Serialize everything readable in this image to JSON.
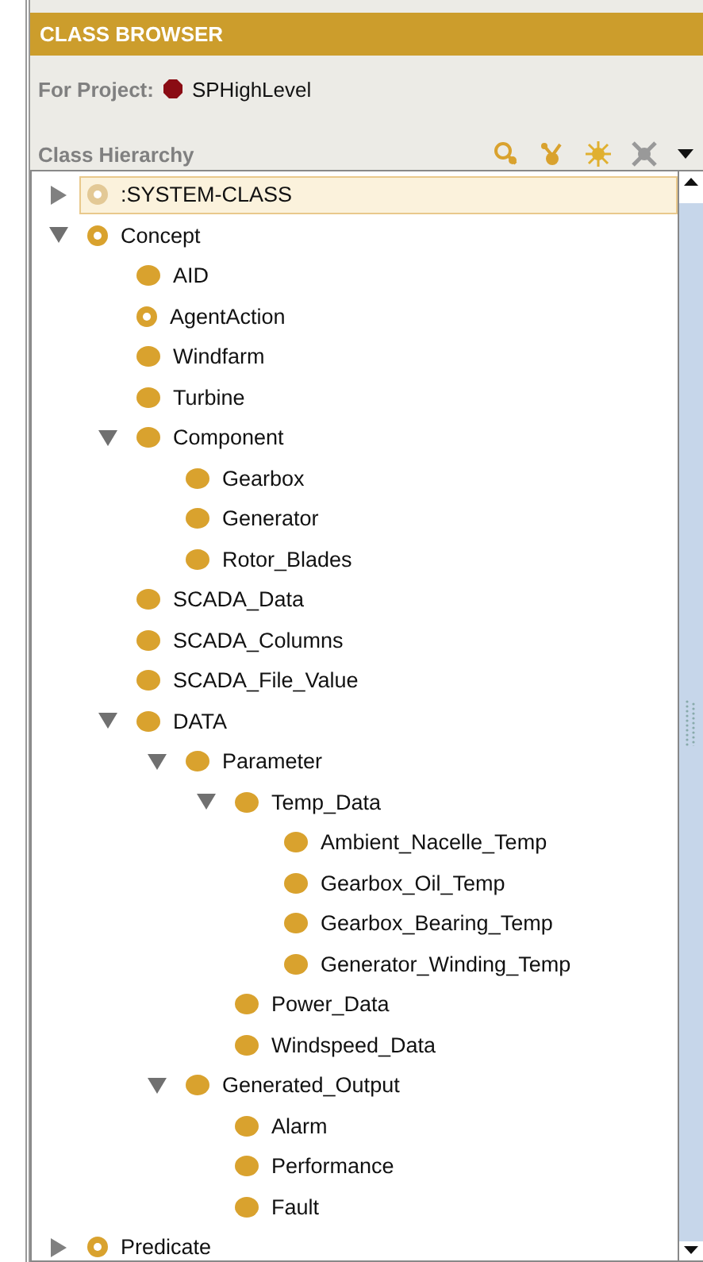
{
  "header": {
    "title": "CLASS BROWSER"
  },
  "project": {
    "label": "For Project:",
    "name": "SPHighLevel"
  },
  "hierarchy": {
    "label": "Class Hierarchy"
  },
  "tree": [
    {
      "label": ":SYSTEM-CLASS",
      "kind": "system",
      "selected": true,
      "expanded": false
    },
    {
      "label": "Concept",
      "kind": "abstract",
      "selected": false,
      "expanded": true,
      "children": [
        {
          "label": "AID",
          "kind": "concrete",
          "selected": false
        },
        {
          "label": "AgentAction",
          "kind": "abstract",
          "selected": false
        },
        {
          "label": "Windfarm",
          "kind": "concrete",
          "selected": false
        },
        {
          "label": "Turbine",
          "kind": "concrete",
          "selected": false
        },
        {
          "label": "Component",
          "kind": "concrete",
          "selected": false,
          "expanded": true,
          "children": [
            {
              "label": "Gearbox",
              "kind": "concrete",
              "selected": false
            },
            {
              "label": "Generator",
              "kind": "concrete",
              "selected": false
            },
            {
              "label": "Rotor_Blades",
              "kind": "concrete",
              "selected": false
            }
          ]
        },
        {
          "label": "SCADA_Data",
          "kind": "concrete",
          "selected": false
        },
        {
          "label": "SCADA_Columns",
          "kind": "concrete",
          "selected": false
        },
        {
          "label": "SCADA_File_Value",
          "kind": "concrete",
          "selected": false
        },
        {
          "label": "DATA",
          "kind": "concrete",
          "selected": false,
          "expanded": true,
          "children": [
            {
              "label": "Parameter",
              "kind": "concrete",
              "selected": false,
              "expanded": true,
              "children": [
                {
                  "label": "Temp_Data",
                  "kind": "concrete",
                  "selected": false,
                  "expanded": true,
                  "children": [
                    {
                      "label": "Ambient_Nacelle_Temp",
                      "kind": "concrete",
                      "selected": false
                    },
                    {
                      "label": "Gearbox_Oil_Temp",
                      "kind": "concrete",
                      "selected": false
                    },
                    {
                      "label": "Gearbox_Bearing_Temp",
                      "kind": "concrete",
                      "selected": false
                    },
                    {
                      "label": "Generator_Winding_Temp",
                      "kind": "concrete",
                      "selected": false
                    }
                  ]
                },
                {
                  "label": "Power_Data",
                  "kind": "concrete",
                  "selected": false
                },
                {
                  "label": "Windspeed_Data",
                  "kind": "concrete",
                  "selected": false
                }
              ]
            },
            {
              "label": "Generated_Output",
              "kind": "concrete",
              "selected": false,
              "expanded": true,
              "children": [
                {
                  "label": "Alarm",
                  "kind": "concrete",
                  "selected": false
                },
                {
                  "label": "Performance",
                  "kind": "concrete",
                  "selected": false
                },
                {
                  "label": "Fault",
                  "kind": "concrete",
                  "selected": false
                }
              ]
            }
          ]
        }
      ]
    },
    {
      "label": "Predicate",
      "kind": "abstract",
      "selected": false,
      "expanded": false
    }
  ]
}
